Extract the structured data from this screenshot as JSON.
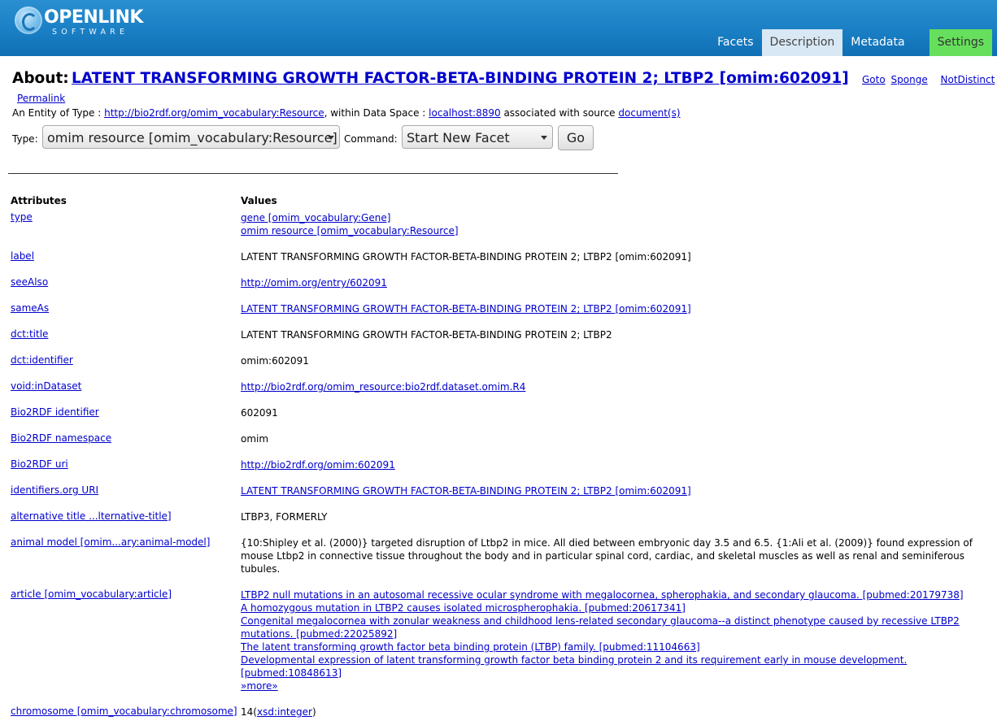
{
  "header": {
    "logo_brand": "OPENLINK",
    "logo_sub": "SOFTWARE",
    "tabs": [
      {
        "label": "Facets"
      },
      {
        "label": "Description"
      },
      {
        "label": "Metadata"
      },
      {
        "label": "Settings"
      }
    ]
  },
  "about": {
    "label": "About:",
    "title": "LATENT TRANSFORMING GROWTH FACTOR-BETA-BINDING PROTEIN 2; LTBP2 [omim:602091]",
    "links": {
      "goto": "Goto",
      "sponge": "Sponge",
      "notdistinct": "NotDistinct"
    },
    "permalink": "Permalink"
  },
  "entity": {
    "prefix": "An Entity of Type : ",
    "type_link": "http://bio2rdf.org/omim_vocabulary:Resource",
    "mid": ", within Data Space : ",
    "space_link": "localhost:8890",
    "suffix": " associated with source ",
    "source_link": "document(s)"
  },
  "controls": {
    "type_label": "Type:",
    "type_value": "omim resource [omim_vocabulary:Resource]",
    "command_label": "Command:",
    "command_value": "Start New Facet",
    "go_label": "Go"
  },
  "table": {
    "headers": {
      "attributes": "Attributes",
      "values": "Values"
    },
    "rows": [
      {
        "attr": "type",
        "values": [
          {
            "text": "gene [omim_vocabulary:Gene]",
            "link": true
          },
          {
            "text": "omim resource [omim_vocabulary:Resource]",
            "link": true
          }
        ]
      },
      {
        "attr": "label",
        "values": [
          {
            "text": "LATENT TRANSFORMING GROWTH FACTOR-BETA-BINDING PROTEIN 2; LTBP2 [omim:602091]",
            "link": false
          }
        ]
      },
      {
        "attr": "seeAlso",
        "values": [
          {
            "text": "http://omim.org/entry/602091",
            "link": true
          }
        ]
      },
      {
        "attr": "sameAs",
        "values": [
          {
            "text": "LATENT TRANSFORMING GROWTH FACTOR-BETA-BINDING PROTEIN 2; LTBP2 [omim:602091]",
            "link": true
          }
        ]
      },
      {
        "attr": "dct:title",
        "values": [
          {
            "text": "LATENT TRANSFORMING GROWTH FACTOR-BETA-BINDING PROTEIN 2; LTBP2",
            "link": false
          }
        ]
      },
      {
        "attr": "dct:identifier",
        "values": [
          {
            "text": "omim:602091",
            "link": false
          }
        ]
      },
      {
        "attr": "void:inDataset",
        "values": [
          {
            "text": "http://bio2rdf.org/omim_resource:bio2rdf.dataset.omim.R4",
            "link": true
          }
        ]
      },
      {
        "attr": "Bio2RDF identifier",
        "values": [
          {
            "text": "602091",
            "link": false
          }
        ]
      },
      {
        "attr": "Bio2RDF namespace",
        "values": [
          {
            "text": "omim",
            "link": false
          }
        ]
      },
      {
        "attr": "Bio2RDF uri",
        "values": [
          {
            "text": "http://bio2rdf.org/omim:602091",
            "link": true
          }
        ]
      },
      {
        "attr": "identifiers.org URI",
        "values": [
          {
            "text": "LATENT TRANSFORMING GROWTH FACTOR-BETA-BINDING PROTEIN 2; LTBP2 [omim:602091]",
            "link": true
          }
        ]
      },
      {
        "attr": "alternative title ...lternative-title]",
        "values": [
          {
            "text": "LTBP3, FORMERLY",
            "link": false
          }
        ]
      },
      {
        "attr": "animal model [omim...ary:animal-model]",
        "values": [
          {
            "text": "{10:Shipley et al. (2000)} targeted disruption of Ltbp2 in mice. All died between embryonic day 3.5 and 6.5. {1:Ali et al. (2009)} found expression of mouse Ltbp2 in connective tissue throughout the body and in particular spinal cord, cardiac, and skeletal muscles as well as renal and seminiferous tubules.",
            "link": false
          }
        ]
      },
      {
        "attr": "article [omim_vocabulary:article]",
        "values": [
          {
            "text": "LTBP2 null mutations in an autosomal recessive ocular syndrome with megalocornea, spherophakia, and secondary glaucoma. [pubmed:20179738]",
            "link": true
          },
          {
            "text": "A homozygous mutation in LTBP2 causes isolated microspherophakia. [pubmed:20617341]",
            "link": true
          },
          {
            "text": "Congenital megalocornea with zonular weakness and childhood lens-related secondary glaucoma--a distinct phenotype caused by recessive LTBP2 mutations. [pubmed:22025892]",
            "link": true
          },
          {
            "text": "The latent transforming growth factor beta binding protein (LTBP) family. [pubmed:11104663]",
            "link": true
          },
          {
            "text": "Developmental expression of latent transforming growth factor beta binding protein 2 and its requirement early in mouse development. [pubmed:10848613]",
            "link": true
          },
          {
            "text": "»more»",
            "link": true
          }
        ]
      },
      {
        "attr": "chromosome [omim_vocabulary:chromosome]",
        "values": [
          {
            "text": "14",
            "link": false
          }
        ],
        "datatype": {
          "pre": "(",
          "link": "xsd:integer",
          "post": ")"
        }
      }
    ]
  }
}
